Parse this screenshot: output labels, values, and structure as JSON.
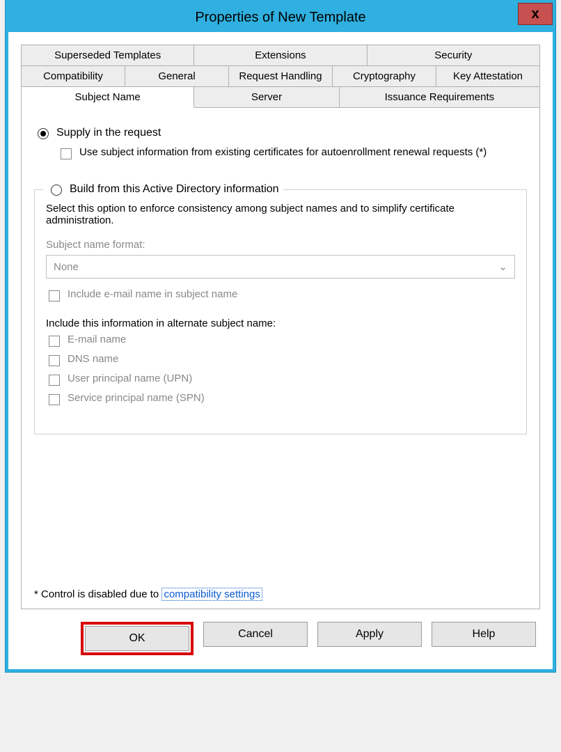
{
  "title": "Properties of New Template",
  "close": "x",
  "tabs": {
    "row1": [
      "Superseded Templates",
      "Extensions",
      "Security"
    ],
    "row2": [
      "Compatibility",
      "General",
      "Request Handling",
      "Cryptography",
      "Key Attestation"
    ],
    "row3": [
      "Subject Name",
      "Server",
      "Issuance Requirements"
    ]
  },
  "supply": {
    "radio": "Supply in the request",
    "useExisting": "Use subject information from existing certificates for autoenrollment renewal requests (*)"
  },
  "build": {
    "radio": "Build from this Active Directory information",
    "desc": "Select this option to enforce consistency among subject names and to simplify certificate administration.",
    "formatLabel": "Subject name format:",
    "formatValue": "None",
    "includeEmail": "Include e-mail name in subject name",
    "altHeader": "Include this information in alternate subject name:",
    "opts": {
      "email": "E-mail name",
      "dns": "DNS name",
      "upn": "User principal name (UPN)",
      "spn": "Service principal name (SPN)"
    }
  },
  "footnote": {
    "prefix": "* Control is disabled due to ",
    "link": "compatibility settings"
  },
  "buttons": {
    "ok": "OK",
    "cancel": "Cancel",
    "apply": "Apply",
    "help": "Help"
  }
}
